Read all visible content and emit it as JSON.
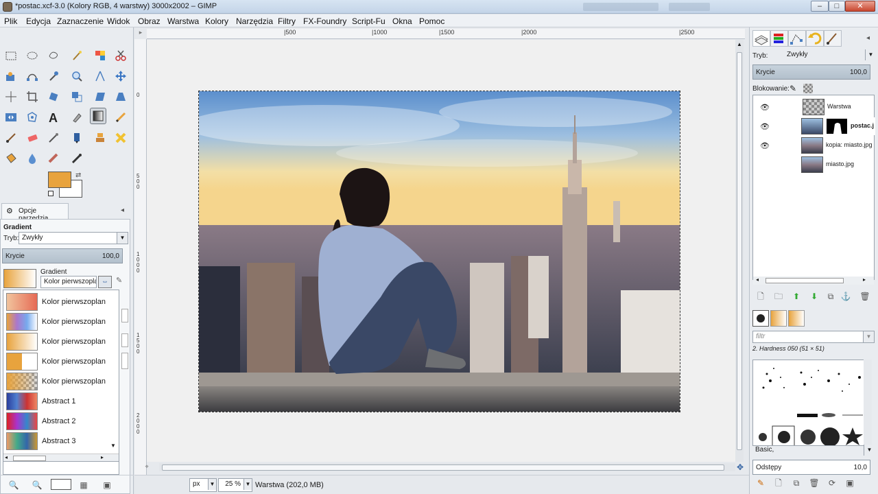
{
  "window": {
    "title": "*postac.xcf-3.0 (Kolory RGB, 4 warstwy) 3000x2002 – GIMP",
    "controls": {
      "minimize": "–",
      "maximize": "□",
      "close": "✕"
    }
  },
  "menubar": {
    "items": [
      "Plik",
      "Edycja",
      "Zaznaczenie",
      "Widok",
      "Obraz",
      "Warstwa",
      "Kolory",
      "Narzędzia",
      "Filtry",
      "FX-Foundry",
      "Script-Fu",
      "Okna",
      "Pomoc"
    ]
  },
  "colors": {
    "foreground": "#e8a33d",
    "background": "#ffffff",
    "accent": "#b3c0cc"
  },
  "toolbox": {
    "tools": [
      "rect-select",
      "ellipse-select",
      "free-select",
      "fuzzy-select",
      "select-by-color",
      "scissors",
      "foreground-select",
      "paths",
      "color-picker",
      "zoom",
      "measure",
      "move",
      "align",
      "crop",
      "rotate",
      "scale",
      "shear",
      "perspective",
      "flip",
      "cage",
      "text",
      "heal",
      "blend",
      "pencil",
      "paintbrush",
      "eraser",
      "airbrush",
      "ink",
      "clone",
      "smudge",
      "dodge",
      "blur",
      "dodge-burn",
      "smudge2",
      "heal2"
    ],
    "active_tool": "blend"
  },
  "tool_options": {
    "tab_label": "Opcje narzędzia",
    "title": "Gradient",
    "mode_label": "Tryb:",
    "mode_value": "Zwykły",
    "opacity_label": "Krycie",
    "opacity_value": "100,0",
    "gradient_label": "Gradient",
    "gradient_value": "Kolor pierwszoplan",
    "gradients": [
      {
        "label": "Kolor pierwszoplan"
      },
      {
        "label": "Kolor pierwszoplan"
      },
      {
        "label": "Kolor pierwszoplan"
      },
      {
        "label": "Kolor pierwszoplan"
      },
      {
        "label": "Kolor pierwszoplan"
      },
      {
        "label": "Abstract 1"
      },
      {
        "label": "Abstract 2"
      },
      {
        "label": "Abstract 3"
      }
    ]
  },
  "rulers": {
    "h": [
      "|500",
      "|1000",
      "|1500",
      "|2000",
      "|2500"
    ],
    "v": [
      "0",
      "500",
      "1000",
      "1500",
      "2000"
    ]
  },
  "statusbar": {
    "unit": "px",
    "zoom": "25 %",
    "info": "Warstwa (202,0 MB)"
  },
  "layers_panel": {
    "mode_label": "Tryb:",
    "mode_value": "Zwykły",
    "opacity_label": "Krycie",
    "opacity_value": "100,0",
    "lock_label": "Blokowanie:",
    "layers": [
      {
        "name": "Warstwa",
        "visible": true
      },
      {
        "name": "postac.jpg",
        "visible": true
      },
      {
        "name": "kopia: miasto.jpg",
        "visible": true
      },
      {
        "name": "miasto.jpg",
        "visible": false
      }
    ]
  },
  "brushes_panel": {
    "filter_placeholder": "filtr",
    "current_brush": "2. Hardness 050 (51 × 51)",
    "preset": "Basic,",
    "spacing_label": "Odstępy",
    "spacing_value": "10,0"
  }
}
